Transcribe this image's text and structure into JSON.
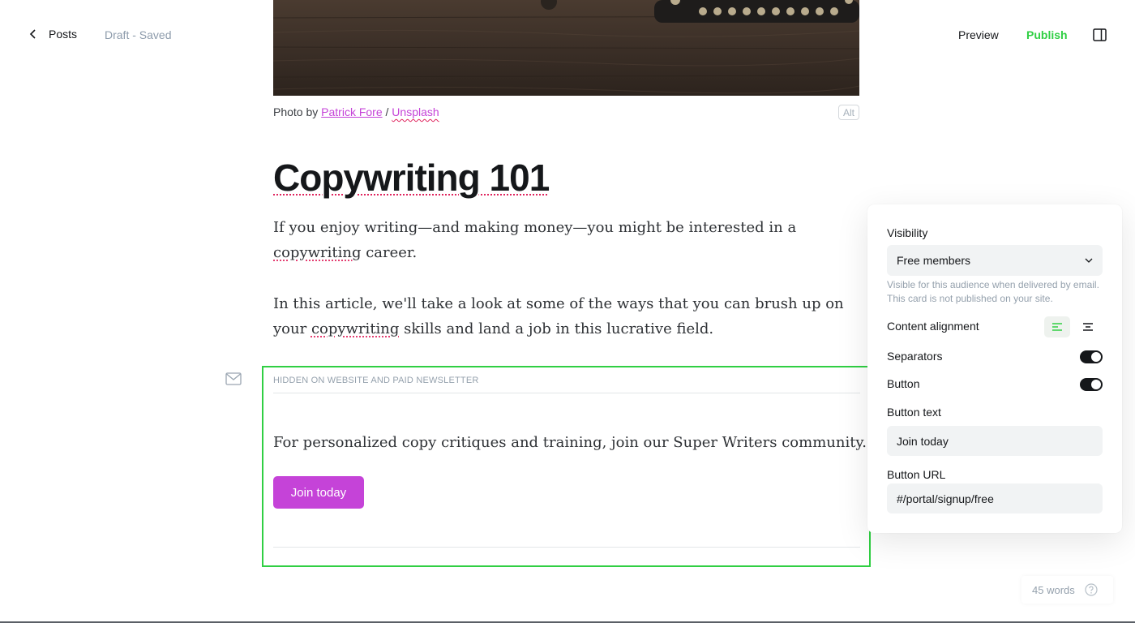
{
  "header": {
    "back_label": "Posts",
    "status": "Draft - Saved",
    "preview_label": "Preview",
    "publish_label": "Publish",
    "accent_color": "#30cf43"
  },
  "feature_image": {
    "caption_prefix": "Photo by ",
    "author": "Patrick Fore",
    "separator": " / ",
    "source": "Unsplash",
    "alt_label": "Alt"
  },
  "post": {
    "title": "Copywriting 101",
    "paragraph1_a": "If you enjoy writing—and making money—you might be interested in a ",
    "paragraph1_word": "copywriting",
    "paragraph1_b": " career.",
    "paragraph2_a": "In this article, we'll take a look at some of the ways that you can brush up on your ",
    "paragraph2_word": "copywriting",
    "paragraph2_b": " skills and land a job in this lucrative field."
  },
  "email_card": {
    "label": "HIDDEN ON WEBSITE AND PAID NEWSLETTER",
    "text": "For personalized copy critiques and training, join our Super Writers community.",
    "button_label": "Join today",
    "button_color": "#c543d8"
  },
  "settings": {
    "visibility_label": "Visibility",
    "visibility_value": "Free members",
    "visibility_help": "Visible for this audience when delivered by email. This card is not published on your site.",
    "alignment_label": "Content alignment",
    "alignment_selected": "left",
    "separators_label": "Separators",
    "separators_on": true,
    "button_label": "Button",
    "button_on": true,
    "button_text_label": "Button text",
    "button_text_value": "Join today",
    "button_url_label": "Button URL",
    "button_url_value": "#/portal/signup/free"
  },
  "footer": {
    "word_count": "45 words"
  }
}
